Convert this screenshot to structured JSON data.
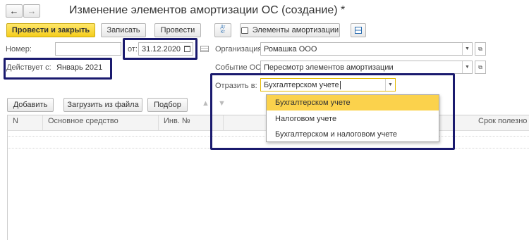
{
  "nav": {
    "back_icon": "arrow-left-icon",
    "forward_icon": "arrow-right-icon"
  },
  "title": "Изменение элементов амортизации ОС (создание) *",
  "toolbar": {
    "post_close": "Провести и закрыть",
    "save": "Записать",
    "post": "Провести",
    "dtkt_top": "Дт",
    "dtkt_bottom": "Кт",
    "elements": "Элементы амортизации"
  },
  "fields": {
    "number_label": "Номер:",
    "number_value": "",
    "date_label": "от:",
    "date_value": "31.12.2020",
    "effective_label": "Действует с:",
    "effective_value": "Январь 2021",
    "org_label": "Организация:",
    "org_value": "Ромашка ООО",
    "event_label": "Событие ОС:",
    "event_value": "Пересмотр элементов амортизации",
    "reflect_label": "Отразить в:",
    "reflect_value": "Бухгалтерском учете"
  },
  "table_toolbar": {
    "add": "Добавить",
    "load": "Загрузить из файла",
    "select": "Подбор"
  },
  "table": {
    "headers": [
      "N",
      "Основное средство",
      "Инв. №",
      "Срок полезно"
    ]
  },
  "dropdown": {
    "options": [
      "Бухгалтерском учете",
      "Налоговом учете",
      "Бухгалтерском и налоговом учете"
    ],
    "selected_index": 0
  },
  "colors": {
    "primary": "#f5cd1c",
    "highlight_border": "#1a1a6e",
    "selected_option": "#fbd24c"
  }
}
